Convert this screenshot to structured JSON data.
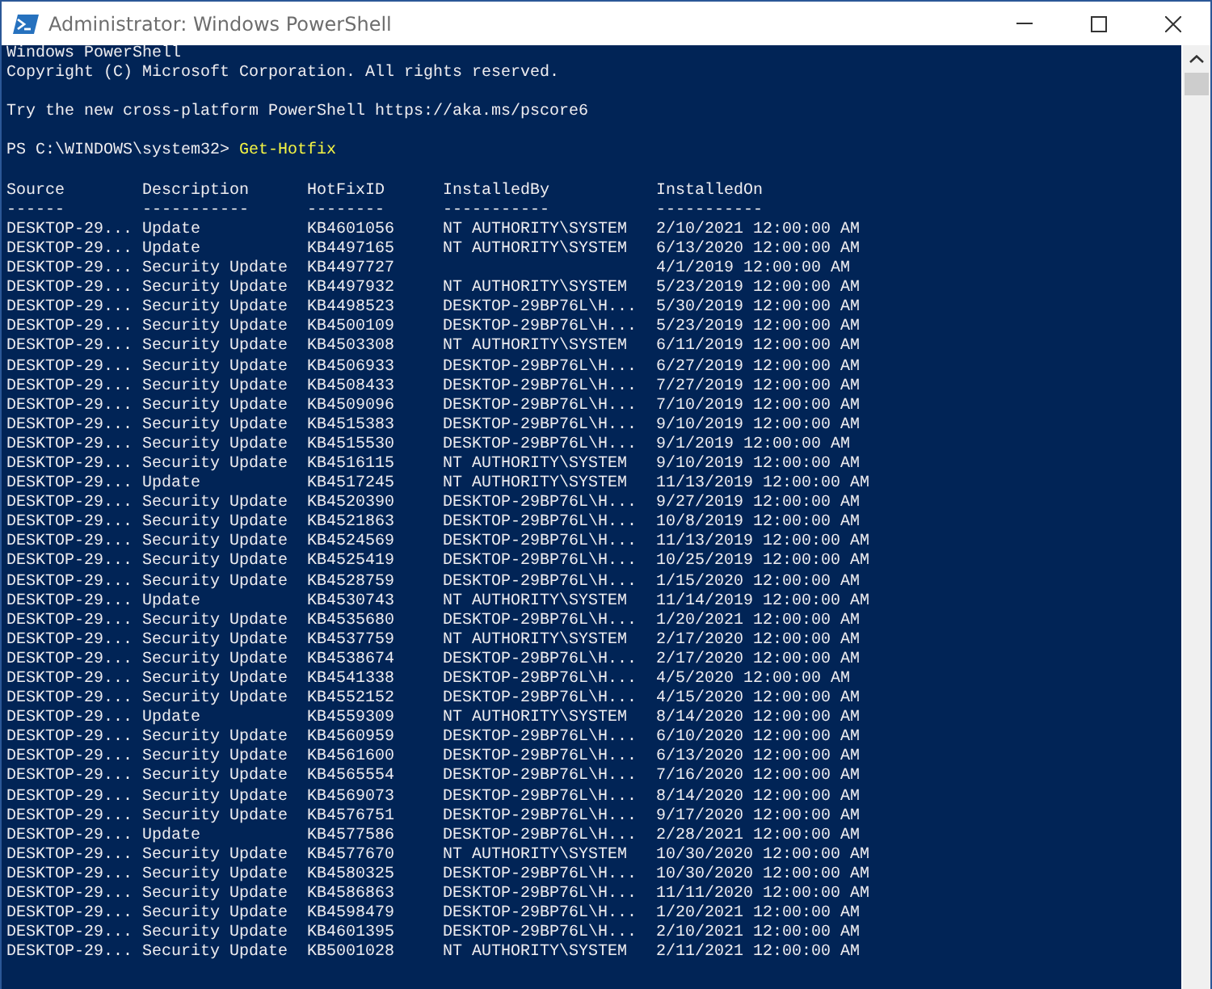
{
  "window": {
    "title": "Administrator: Windows PowerShell"
  },
  "console": {
    "banner": [
      "Windows PowerShell",
      "Copyright (C) Microsoft Corporation. All rights reserved."
    ],
    "tip": "Try the new cross-platform PowerShell https://aka.ms/pscore6",
    "prompt": {
      "path": "PS C:\\WINDOWS\\system32>",
      "command": "Get-Hotfix"
    },
    "table": {
      "columns": [
        {
          "header": "Source",
          "rule": "------"
        },
        {
          "header": "Description",
          "rule": "-----------"
        },
        {
          "header": "HotFixID",
          "rule": "--------"
        },
        {
          "header": "InstalledBy",
          "rule": "-----------"
        },
        {
          "header": "InstalledOn",
          "rule": "-----------"
        }
      ],
      "rows": [
        [
          "DESKTOP-29...",
          "Update",
          "KB4601056",
          "NT AUTHORITY\\SYSTEM",
          "2/10/2021 12:00:00 AM"
        ],
        [
          "DESKTOP-29...",
          "Update",
          "KB4497165",
          "NT AUTHORITY\\SYSTEM",
          "6/13/2020 12:00:00 AM"
        ],
        [
          "DESKTOP-29...",
          "Security Update",
          "KB4497727",
          null,
          "4/1/2019 12:00:00 AM"
        ],
        [
          "DESKTOP-29...",
          "Security Update",
          "KB4497932",
          "NT AUTHORITY\\SYSTEM",
          "5/23/2019 12:00:00 AM"
        ],
        [
          "DESKTOP-29...",
          "Security Update",
          "KB4498523",
          "DESKTOP-29BP76L\\H...",
          "5/30/2019 12:00:00 AM"
        ],
        [
          "DESKTOP-29...",
          "Security Update",
          "KB4500109",
          "DESKTOP-29BP76L\\H...",
          "5/23/2019 12:00:00 AM"
        ],
        [
          "DESKTOP-29...",
          "Security Update",
          "KB4503308",
          "NT AUTHORITY\\SYSTEM",
          "6/11/2019 12:00:00 AM"
        ],
        [
          "DESKTOP-29...",
          "Security Update",
          "KB4506933",
          "DESKTOP-29BP76L\\H...",
          "6/27/2019 12:00:00 AM"
        ],
        [
          "DESKTOP-29...",
          "Security Update",
          "KB4508433",
          "DESKTOP-29BP76L\\H...",
          "7/27/2019 12:00:00 AM"
        ],
        [
          "DESKTOP-29...",
          "Security Update",
          "KB4509096",
          "DESKTOP-29BP76L\\H...",
          "7/10/2019 12:00:00 AM"
        ],
        [
          "DESKTOP-29...",
          "Security Update",
          "KB4515383",
          "DESKTOP-29BP76L\\H...",
          "9/10/2019 12:00:00 AM"
        ],
        [
          "DESKTOP-29...",
          "Security Update",
          "KB4515530",
          "DESKTOP-29BP76L\\H...",
          "9/1/2019 12:00:00 AM"
        ],
        [
          "DESKTOP-29...",
          "Security Update",
          "KB4516115",
          "NT AUTHORITY\\SYSTEM",
          "9/10/2019 12:00:00 AM"
        ],
        [
          "DESKTOP-29...",
          "Update",
          "KB4517245",
          "NT AUTHORITY\\SYSTEM",
          "11/13/2019 12:00:00 AM"
        ],
        [
          "DESKTOP-29...",
          "Security Update",
          "KB4520390",
          "DESKTOP-29BP76L\\H...",
          "9/27/2019 12:00:00 AM"
        ],
        [
          "DESKTOP-29...",
          "Security Update",
          "KB4521863",
          "DESKTOP-29BP76L\\H...",
          "10/8/2019 12:00:00 AM"
        ],
        [
          "DESKTOP-29...",
          "Security Update",
          "KB4524569",
          "DESKTOP-29BP76L\\H...",
          "11/13/2019 12:00:00 AM"
        ],
        [
          "DESKTOP-29...",
          "Security Update",
          "KB4525419",
          "DESKTOP-29BP76L\\H...",
          "10/25/2019 12:00:00 AM"
        ],
        [
          "DESKTOP-29...",
          "Security Update",
          "KB4528759",
          "DESKTOP-29BP76L\\H...",
          "1/15/2020 12:00:00 AM"
        ],
        [
          "DESKTOP-29...",
          "Update",
          "KB4530743",
          "NT AUTHORITY\\SYSTEM",
          "11/14/2019 12:00:00 AM"
        ],
        [
          "DESKTOP-29...",
          "Security Update",
          "KB4535680",
          "DESKTOP-29BP76L\\H...",
          "1/20/2021 12:00:00 AM"
        ],
        [
          "DESKTOP-29...",
          "Security Update",
          "KB4537759",
          "NT AUTHORITY\\SYSTEM",
          "2/17/2020 12:00:00 AM"
        ],
        [
          "DESKTOP-29...",
          "Security Update",
          "KB4538674",
          "DESKTOP-29BP76L\\H...",
          "2/17/2020 12:00:00 AM"
        ],
        [
          "DESKTOP-29...",
          "Security Update",
          "KB4541338",
          "DESKTOP-29BP76L\\H...",
          "4/5/2020 12:00:00 AM"
        ],
        [
          "DESKTOP-29...",
          "Security Update",
          "KB4552152",
          "DESKTOP-29BP76L\\H...",
          "4/15/2020 12:00:00 AM"
        ],
        [
          "DESKTOP-29...",
          "Update",
          "KB4559309",
          "NT AUTHORITY\\SYSTEM",
          "8/14/2020 12:00:00 AM"
        ],
        [
          "DESKTOP-29...",
          "Security Update",
          "KB4560959",
          "DESKTOP-29BP76L\\H...",
          "6/10/2020 12:00:00 AM"
        ],
        [
          "DESKTOP-29...",
          "Security Update",
          "KB4561600",
          "DESKTOP-29BP76L\\H...",
          "6/13/2020 12:00:00 AM"
        ],
        [
          "DESKTOP-29...",
          "Security Update",
          "KB4565554",
          "DESKTOP-29BP76L\\H...",
          "7/16/2020 12:00:00 AM"
        ],
        [
          "DESKTOP-29...",
          "Security Update",
          "KB4569073",
          "DESKTOP-29BP76L\\H...",
          "8/14/2020 12:00:00 AM"
        ],
        [
          "DESKTOP-29...",
          "Security Update",
          "KB4576751",
          "DESKTOP-29BP76L\\H...",
          "9/17/2020 12:00:00 AM"
        ],
        [
          "DESKTOP-29...",
          "Update",
          "KB4577586",
          "DESKTOP-29BP76L\\H...",
          "2/28/2021 12:00:00 AM"
        ],
        [
          "DESKTOP-29...",
          "Security Update",
          "KB4577670",
          "NT AUTHORITY\\SYSTEM",
          "10/30/2020 12:00:00 AM"
        ],
        [
          "DESKTOP-29...",
          "Security Update",
          "KB4580325",
          "DESKTOP-29BP76L\\H...",
          "10/30/2020 12:00:00 AM"
        ],
        [
          "DESKTOP-29...",
          "Security Update",
          "KB4586863",
          "DESKTOP-29BP76L\\H...",
          "11/11/2020 12:00:00 AM"
        ],
        [
          "DESKTOP-29...",
          "Security Update",
          "KB4598479",
          "DESKTOP-29BP76L\\H...",
          "1/20/2021 12:00:00 AM"
        ],
        [
          "DESKTOP-29...",
          "Security Update",
          "KB4601395",
          "DESKTOP-29BP76L\\H...",
          "2/10/2021 12:00:00 AM"
        ],
        [
          "DESKTOP-29...",
          "Security Update",
          "KB5001028",
          "NT AUTHORITY\\SYSTEM",
          "2/11/2021 12:00:00 AM"
        ]
      ]
    }
  }
}
